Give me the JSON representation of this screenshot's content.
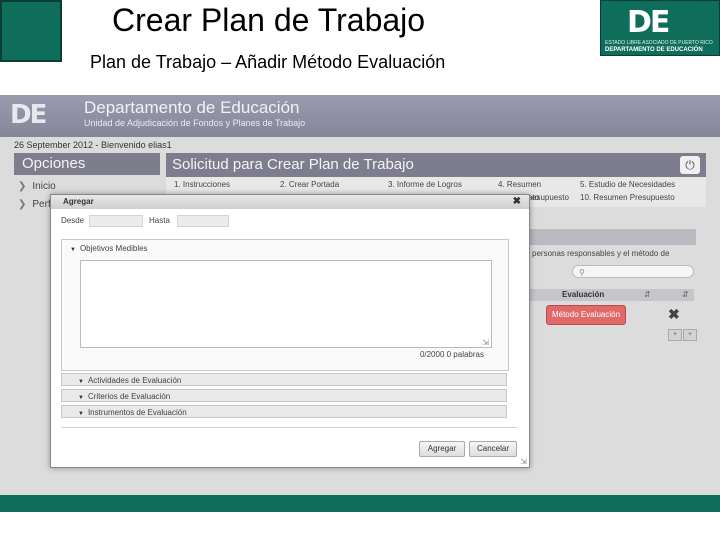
{
  "slide": {
    "title": "Crear Plan de Trabajo",
    "subtitle": "Plan de Trabajo – Añadir Método Evaluación",
    "logo": {
      "mark": "DE",
      "line1": "ESTADO LIBRE ASOCIADO DE PUERTO RICO",
      "line2": "DEPARTAMENTO DE EDUCACIÓN"
    }
  },
  "app": {
    "brand_logo": "DE",
    "brand_title": "Departamento de Educación",
    "brand_subtitle": "Unidad de Adjudicación de Fondos y Planes de Trabajo",
    "date_line": "26 September 2012 - Bienvenido elias1",
    "options": {
      "header": "Opciones",
      "items": [
        "Inicio",
        "Perfil"
      ]
    },
    "request": {
      "title": "Solicitud para Crear Plan de Trabajo",
      "steps": [
        "1. Instrucciones",
        "2. Crear Portada",
        "3. Informe de Logros",
        "4. Resumen",
        "5. Estudio de Necesidades",
        "ato",
        "esupuesto",
        "10. Resumen Presupuesto"
      ]
    },
    "background": {
      "description_fragment": "personas responsables y el método de",
      "search_icon": "search-icon",
      "column_header": "Evaluación",
      "metodo_button": "Método Evaluación"
    }
  },
  "modal": {
    "title": "Agregar",
    "desde_label": "Desde",
    "hasta_label": "Hasta",
    "section_title": "Objetivos Medibles",
    "word_count": "0/2000 0 palabras",
    "accordions": [
      "Actividades de Evaluación",
      "Criterios de Evaluación",
      "Instrumentos de Evaluación"
    ],
    "agregar_button": "Agregar",
    "cancelar_button": "Cancelar"
  },
  "colors": {
    "brand_green": "#0f6e5b",
    "header_gray": "#7d7d8d",
    "accent_red": "#e06a6a"
  }
}
